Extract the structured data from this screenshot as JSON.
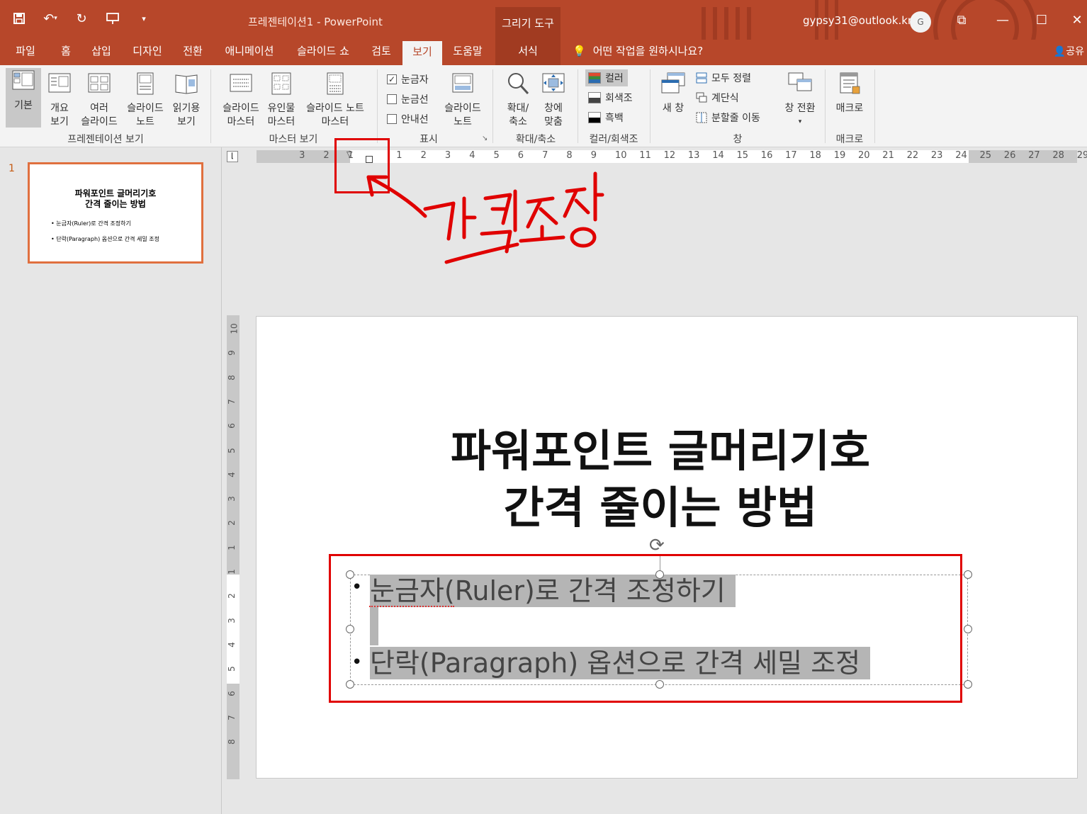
{
  "titlebar": {
    "doc_title": "프레젠테이션1  -  PowerPoint",
    "context_group": "그리기 도구",
    "account": "gypsy31@outlook.kr",
    "avatar_initial": "G",
    "qat_icons": [
      "save-icon",
      "undo-icon",
      "redo-icon",
      "present-icon",
      "customize-icon"
    ]
  },
  "tabs": [
    {
      "label": "파일"
    },
    {
      "label": "홈"
    },
    {
      "label": "삽입"
    },
    {
      "label": "디자인"
    },
    {
      "label": "전환"
    },
    {
      "label": "애니메이션"
    },
    {
      "label": "슬라이드 쇼"
    },
    {
      "label": "검토"
    },
    {
      "label": "보기"
    },
    {
      "label": "도움말"
    },
    {
      "label": "서식"
    }
  ],
  "tellme": "어떤 작업을 원하시나요?",
  "share": "공유",
  "ribbon": {
    "pres_views": {
      "basic": "기본",
      "outline_1": "개요",
      "outline_2": "보기",
      "sorter_1": "여러",
      "sorter_2": "슬라이드",
      "notes_1": "슬라이드",
      "notes_2": "노트",
      "reading_1": "읽기용",
      "reading_2": "보기",
      "group": "프레젠테이션 보기"
    },
    "master_views": {
      "slide_master_1": "슬라이드",
      "slide_master_2": "마스터",
      "handout_1": "유인물",
      "handout_2": "마스터",
      "notes_master_1": "슬라이드 노트",
      "notes_master_2": "마스터",
      "group": "마스터 보기"
    },
    "show": {
      "ruler": "눈금자",
      "gridlines": "눈금선",
      "guides": "안내선",
      "notes_1": "슬라이드",
      "notes_2": "노트",
      "group": "표시"
    },
    "zoom": {
      "zoom_1": "확대/",
      "zoom_2": "축소",
      "fit_1": "창에",
      "fit_2": "맞춤",
      "group": "확대/축소"
    },
    "color": {
      "color": "컬러",
      "grayscale": "회색조",
      "bw": "흑백",
      "group": "컬러/회색조"
    },
    "window": {
      "new_window": "새 창",
      "arrange_all": "모두 정렬",
      "cascade": "계단식",
      "move_split": "분할줄 이동",
      "switch": "창 전환",
      "group": "창"
    },
    "macros": {
      "macros": "매크로",
      "group": "매크로"
    }
  },
  "ruler": {
    "left_labels": [
      "3",
      "2",
      "1"
    ],
    "right_labels": [
      "1",
      "2",
      "3",
      "4",
      "5",
      "6",
      "7",
      "8",
      "9",
      "10",
      "11",
      "12",
      "13",
      "14",
      "15",
      "16",
      "17",
      "18",
      "19",
      "20",
      "21",
      "22",
      "23",
      "24",
      "25",
      "26",
      "27",
      "28",
      "29"
    ],
    "vertical_labels": [
      "10",
      "9",
      "8",
      "7",
      "6",
      "5",
      "4",
      "3",
      "2",
      "1",
      "1",
      "2",
      "3",
      "4",
      "5",
      "6",
      "7",
      "8"
    ]
  },
  "thumbnail": {
    "number": "1",
    "title_1": "파워포인트 글머리기호",
    "title_2": "간격 줄이는 방법",
    "bullet_1": "• 눈금자(Ruler)로 간격 조정하기",
    "bullet_2": "• 단락(Paragraph) 옵션으로 간격 세밀 조정"
  },
  "slide": {
    "title_1": "파워포인트 글머리기호",
    "title_2": "간격 줄이는 방법",
    "bullet_1": "눈금자(Ruler)로 간격 조정하기",
    "bullet_2": "단락(Paragraph) 옵션으로 간격 세밀 조정"
  },
  "annotation": {
    "handwritten_text": "간격조정",
    "color": "#e00000"
  },
  "colors": {
    "accent": "#b7472a",
    "ribbon_bg": "#f3f3f3",
    "selection_highlight": "#b5b5b5"
  }
}
